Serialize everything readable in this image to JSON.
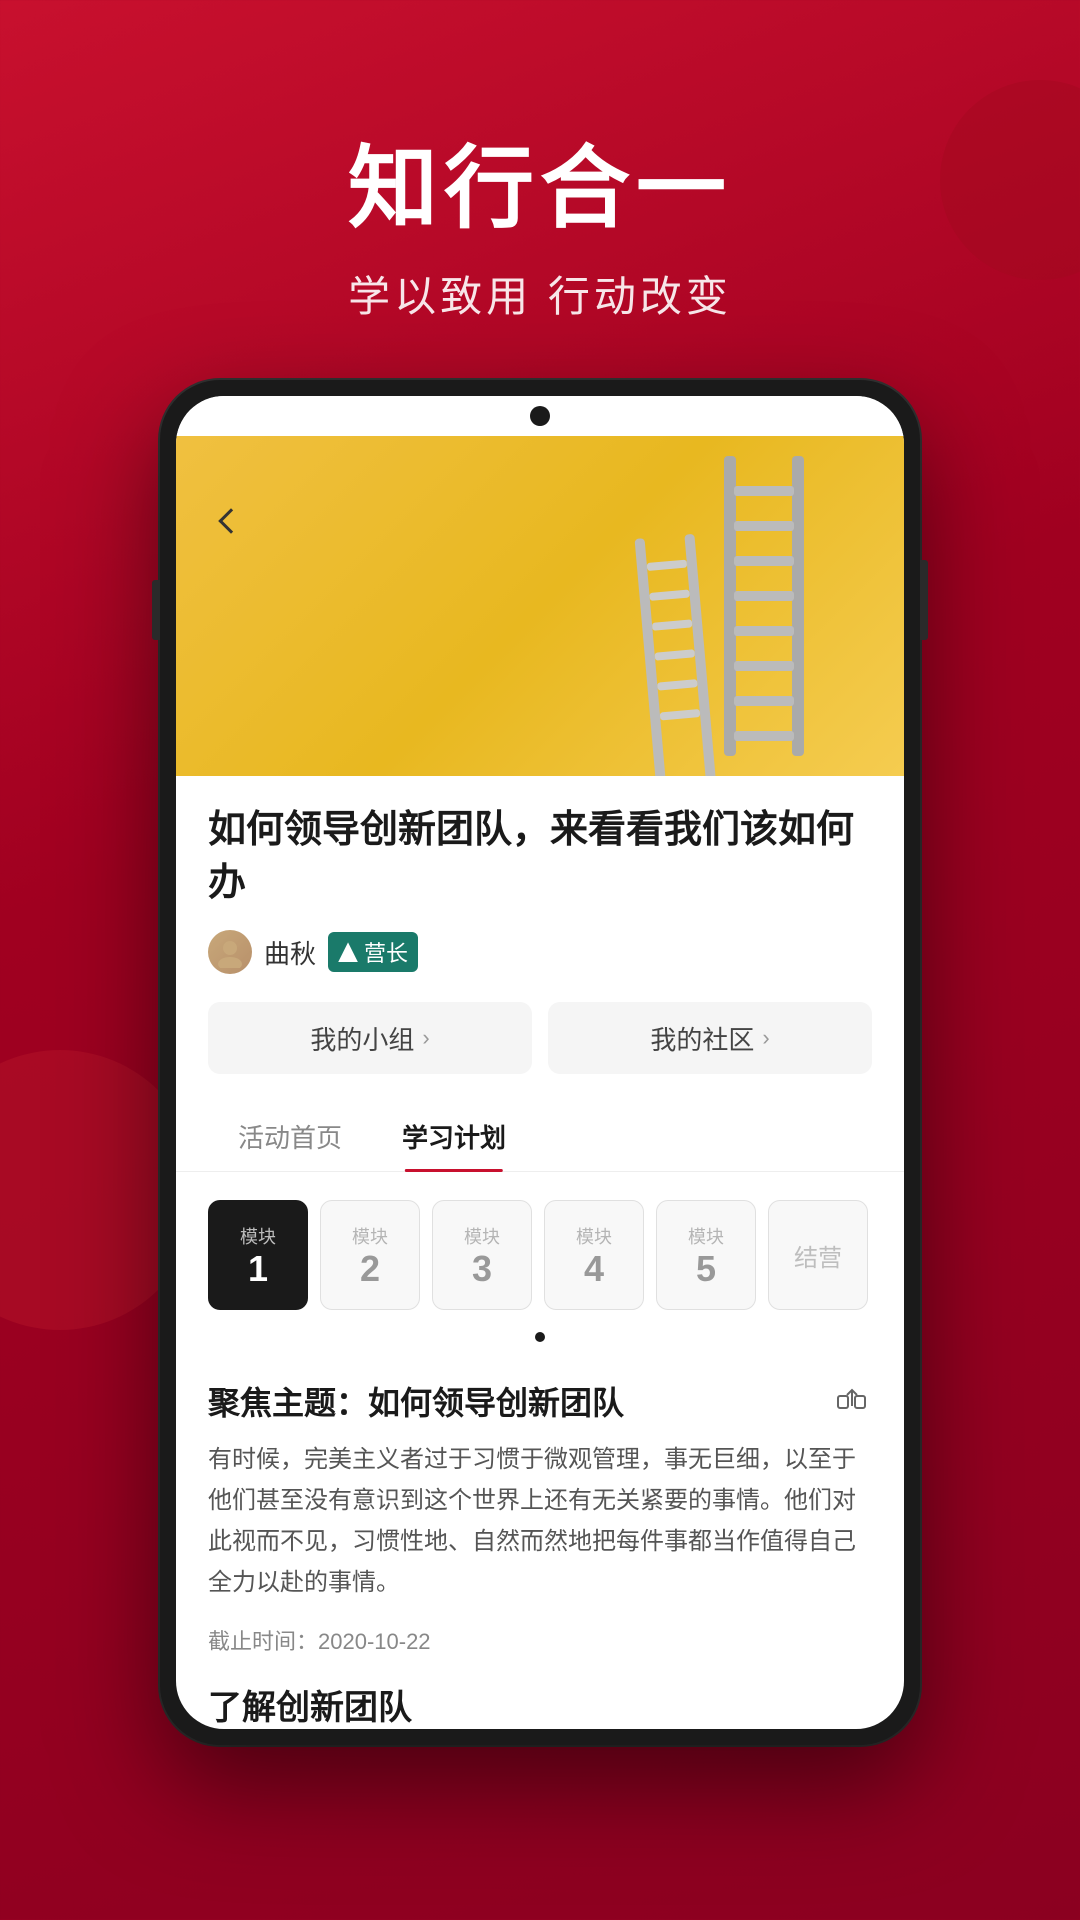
{
  "hero": {
    "title": "知行合一",
    "subtitle": "学以致用 行动改变"
  },
  "phone": {
    "article": {
      "title": "如何领导创新团队，来看看我们该如何办",
      "author_name": "曲秋",
      "rank_label": "营长",
      "nav_button_group": "我的小组",
      "nav_button_community": "我的社区"
    },
    "tabs": [
      {
        "label": "活动首页",
        "active": false
      },
      {
        "label": "学习计划",
        "active": true
      }
    ],
    "modules": [
      {
        "label": "模块",
        "num": "1",
        "active": true
      },
      {
        "label": "模块",
        "num": "2",
        "active": false
      },
      {
        "label": "模块",
        "num": "3",
        "active": false
      },
      {
        "label": "模块",
        "num": "4",
        "active": false
      },
      {
        "label": "模块",
        "num": "5",
        "active": false
      },
      {
        "label": "结营",
        "num": "",
        "active": false
      }
    ],
    "focus": {
      "title": "聚焦主题：如何领导创新团队",
      "body": "有时候，完美主义者过于习惯于微观管理，事无巨细，以至于他们甚至没有意识到这个世界上还有无关紧要的事情。他们对此视而不见，习惯性地、自然而然地把每件事都当作值得自己全力以赴的事情。",
      "deadline_label": "截止时间：2020-10-22",
      "section_title": "了解创新团队"
    }
  }
}
